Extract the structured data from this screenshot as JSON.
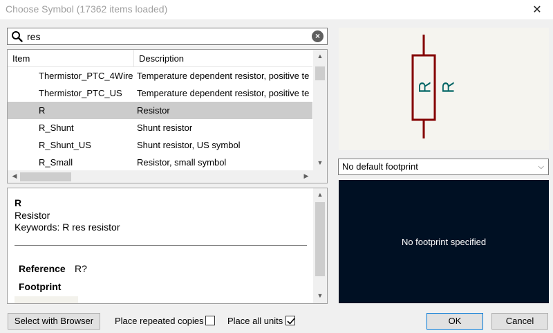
{
  "window": {
    "title": "Choose Symbol (17362 items loaded)",
    "close_glyph": "✕"
  },
  "search": {
    "value": "res",
    "icon": "search-icon",
    "clear_glyph": "×"
  },
  "list": {
    "columns": {
      "item": "Item",
      "description": "Description"
    },
    "rows": [
      {
        "item": "Thermistor_PTC_4Wire",
        "description": "Temperature dependent resistor, positive te"
      },
      {
        "item": "Thermistor_PTC_US",
        "description": "Temperature dependent resistor, positive te"
      },
      {
        "item": "R",
        "description": "Resistor"
      },
      {
        "item": "R_Shunt",
        "description": "Shunt resistor"
      },
      {
        "item": "R_Shunt_US",
        "description": "Shunt resistor, US symbol"
      },
      {
        "item": "R_Small",
        "description": "Resistor, small symbol"
      }
    ],
    "selected_index": 2
  },
  "details": {
    "name": "R",
    "description": "Resistor",
    "keywords": "Keywords: R res resistor",
    "reference_label": "Reference",
    "reference_value": "R?",
    "footprint_label": "Footprint"
  },
  "preview": {
    "ref_text": "R",
    "value_text": "R",
    "symbol_color": "#840000",
    "text_color": "#006464"
  },
  "footprint": {
    "selected": "No default footprint",
    "canvas_message": "No footprint specified"
  },
  "buttons": {
    "select_with_browser": "Select with Browser",
    "place_repeated_label": "Place repeated copies",
    "place_repeated_checked": false,
    "place_all_units_label": "Place all units",
    "place_all_units_checked": true,
    "ok": "OK",
    "cancel": "Cancel"
  }
}
